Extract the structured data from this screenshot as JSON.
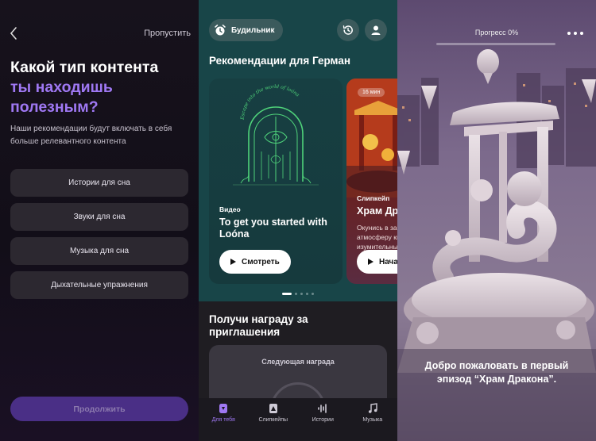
{
  "onboarding": {
    "skip_label": "Пропустить",
    "title_line1": "Какой тип контента",
    "title_accent": "ты находишь полезным?",
    "subtitle": "Наши рекомендации будут включать в себя больше релевантного контента",
    "options": [
      "Истории для сна",
      "Звуки для сна",
      "Музыка для сна",
      "Дыхательные упражнения"
    ],
    "continue_label": "Продолжить",
    "accent_color": "#9f78f3"
  },
  "home": {
    "alarm_label": "Будильник",
    "recommendations_title": "Рекомендации для Герман",
    "cards": [
      {
        "kind": "Видео",
        "name": "To get you started with Loóna",
        "button": "Смотреть",
        "art_text": "Escape into the world of loóna"
      },
      {
        "badge": "16 мин",
        "kind": "Слипкейп",
        "name": "Храм Дракона",
        "desc": "Окунись в загадочную атмосферу китайских изумительных",
        "button": "Начать"
      }
    ],
    "invite_title": "Получи награду за приглашения",
    "reward_label": "Следующая награда",
    "tabs": [
      {
        "label": "Для тебя",
        "icon": "home-icon",
        "active": true
      },
      {
        "label": "Слипкейпы",
        "icon": "sleepscape-icon",
        "active": false
      },
      {
        "label": "Истории",
        "icon": "stories-icon",
        "active": false
      },
      {
        "label": "Музыка",
        "icon": "music-icon",
        "active": false
      }
    ]
  },
  "player": {
    "progress_label": "Прогресс 0%",
    "progress_value": 0,
    "welcome_text": "Добро пожаловать в первый эпизод “Храм Дракона”."
  }
}
